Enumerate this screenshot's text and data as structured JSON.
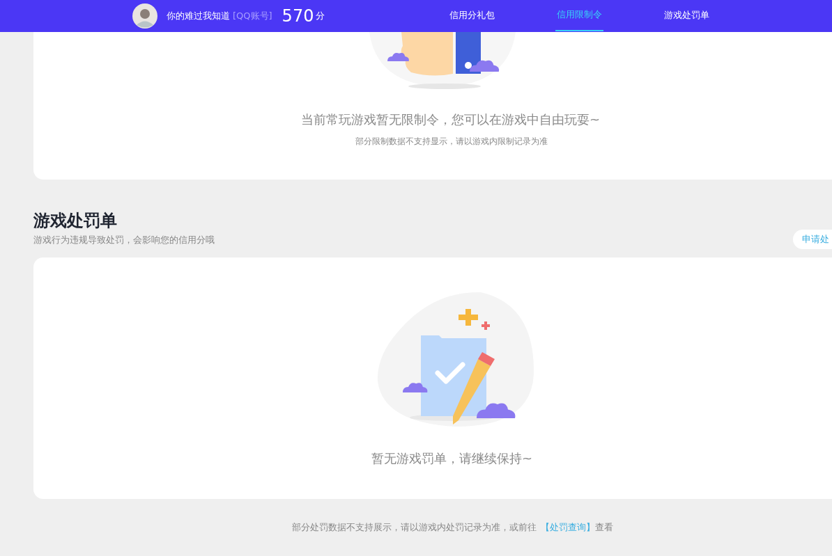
{
  "header": {
    "user": {
      "name": "你的难过我知道",
      "account_type": "[QQ账号]",
      "score": "570",
      "score_unit": "分"
    },
    "nav": [
      {
        "label": "信用分礼包",
        "selected": false
      },
      {
        "label": "信用限制令",
        "selected": true
      },
      {
        "label": "游戏处罚单",
        "selected": false
      }
    ]
  },
  "restriction_card": {
    "message": "当前常玩游戏暂无限制令，您可以在游戏中自由玩耍~",
    "note": "部分限制数据不支持显示，请以游戏内限制记录为准"
  },
  "penalty_section": {
    "title": "游戏处罚单",
    "subtitle": "游戏行为违规导致处罚，会影响您的信用分哦",
    "apply_button": "申请处",
    "empty_message": "暂无游戏罚单，请继续保持~",
    "footer": {
      "text": "部分处罚数据不支持展示，请以游戏内处罚记录为准，或前往",
      "link": "【处罚查询】",
      "suffix": "查看"
    }
  }
}
